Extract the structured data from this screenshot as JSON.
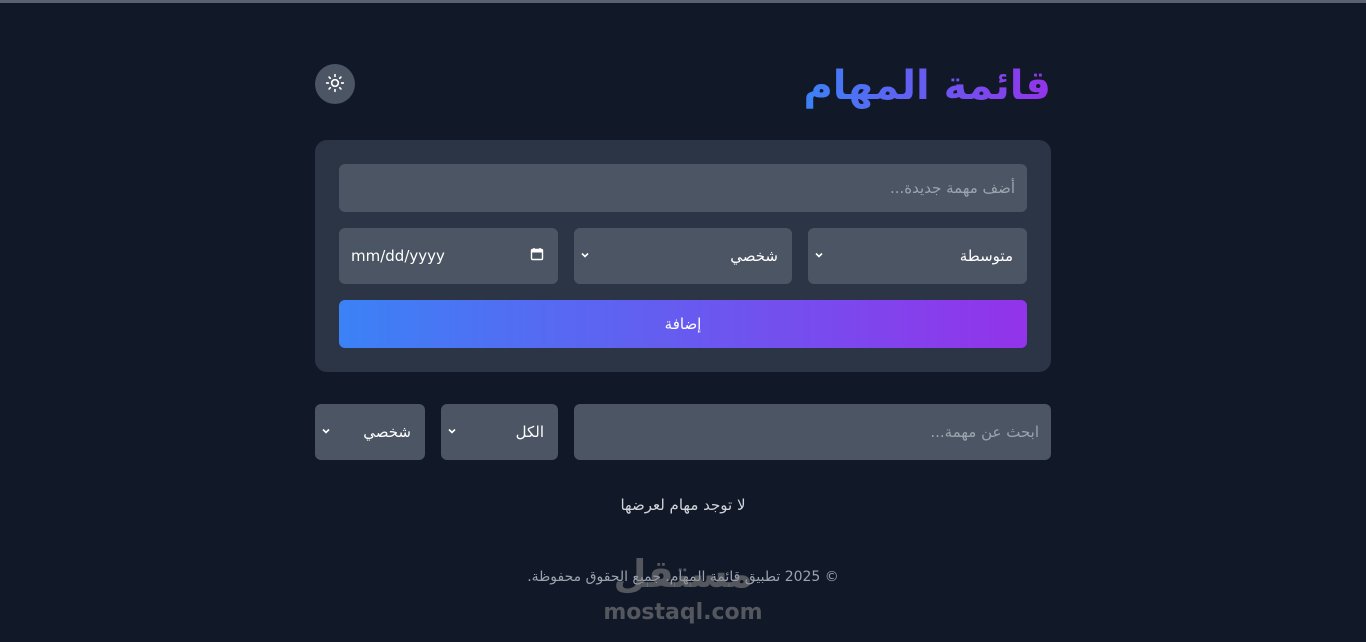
{
  "header": {
    "title": "قائمة المهام",
    "theme_toggle_icon": "sun-icon"
  },
  "form": {
    "task_placeholder": "أضف مهمة جديدة...",
    "priority_value": "متوسطة",
    "category_value": "شخصي",
    "date_placeholder": "mm/dd/yyyy",
    "add_label": "إضافة"
  },
  "filters": {
    "search_placeholder": "ابحث عن مهمة...",
    "status_value": "الكل",
    "category_value": "شخصي"
  },
  "empty_message": "لا توجد مهام لعرضها",
  "footer": "© 2025 تطبيق قائمة المهام. جميع الحقوق محفوظة.",
  "watermark": {
    "arabic": "مستقل",
    "latin": "mostaql.com"
  },
  "colors": {
    "background": "#111827",
    "card": "#2c3546",
    "field": "#4b5563",
    "gradient_start": "#3b82f6",
    "gradient_end": "#9333ea"
  }
}
